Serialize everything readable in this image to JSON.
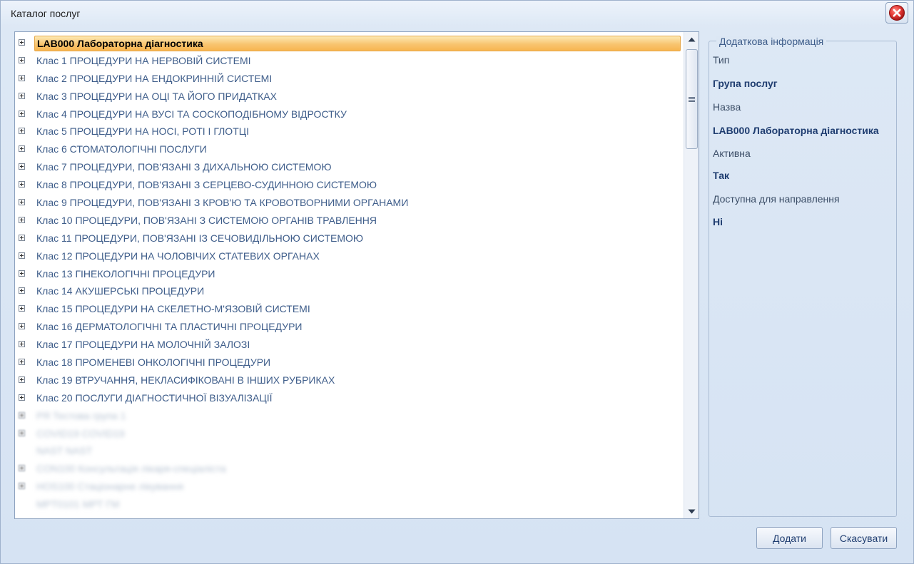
{
  "window": {
    "title": "Каталог послуг"
  },
  "tree": {
    "items": [
      {
        "label": "LAB000 Лабораторна діагностика",
        "selected": true,
        "expandable": true
      },
      {
        "label": "Клас 1 ПРОЦЕДУРИ НА НЕРВОВІЙ СИСТЕМІ",
        "expandable": true
      },
      {
        "label": "Клас 2 ПРОЦЕДУРИ НА ЕНДОКРИННІЙ СИСТЕМІ",
        "expandable": true
      },
      {
        "label": "Клас 3 ПРОЦЕДУРИ НА ОЦІ ТА ЙОГО ПРИДАТКАХ",
        "expandable": true
      },
      {
        "label": "Клас 4 ПРОЦЕДУРИ НА ВУСІ ТА СОСКОПОДІБНОМУ ВІДРОСТКУ",
        "expandable": true
      },
      {
        "label": "Клас 5 ПРОЦЕДУРИ НА НОСІ, РОТІ І ГЛОТЦІ",
        "expandable": true
      },
      {
        "label": "Клас 6 СТОМАТОЛОГІЧНІ ПОСЛУГИ",
        "expandable": true
      },
      {
        "label": "Клас 7 ПРОЦЕДУРИ, ПОВ'ЯЗАНІ З ДИХАЛЬНОЮ СИСТЕМОЮ",
        "expandable": true
      },
      {
        "label": "Клас 8 ПРОЦЕДУРИ, ПОВ'ЯЗАНІ З СЕРЦЕВО-СУДИННОЮ СИСТЕМОЮ",
        "expandable": true
      },
      {
        "label": "Клас 9 ПРОЦЕДУРИ, ПОВ'ЯЗАНІ З КРОВ'Ю ТА КРОВОТВОРНИМИ ОРГАНАМИ",
        "expandable": true
      },
      {
        "label": "Клас 10 ПРОЦЕДУРИ, ПОВ'ЯЗАНІ З СИСТЕМОЮ ОРГАНІВ ТРАВЛЕННЯ",
        "expandable": true
      },
      {
        "label": "Клас 11 ПРОЦЕДУРИ, ПОВ'ЯЗАНІ ІЗ СЕЧОВИДІЛЬНОЮ СИСТЕМОЮ",
        "expandable": true
      },
      {
        "label": "Клас 12 ПРОЦЕДУРИ НА ЧОЛОВІЧИХ СТАТЕВИХ ОРГАНАХ",
        "expandable": true
      },
      {
        "label": "Клас 13 ГІНЕКОЛОГІЧНІ ПРОЦЕДУРИ",
        "expandable": true
      },
      {
        "label": "Клас 14 АКУШЕРСЬКІ ПРОЦЕДУРИ",
        "expandable": true
      },
      {
        "label": "Клас 15 ПРОЦЕДУРИ НА СКЕЛЕТНО-М'ЯЗОВІЙ СИСТЕМІ",
        "expandable": true
      },
      {
        "label": "Клас 16 ДЕРМАТОЛОГІЧНІ ТА ПЛАСТИЧНІ ПРОЦЕДУРИ",
        "expandable": true
      },
      {
        "label": "Клас 17 ПРОЦЕДУРИ НА МОЛОЧНІЙ ЗАЛОЗІ",
        "expandable": true
      },
      {
        "label": "Клас 18 ПРОМЕНЕВІ ОНКОЛОГІЧНІ ПРОЦЕДУРИ",
        "expandable": true
      },
      {
        "label": "Клас 19 ВТРУЧАННЯ, НЕКЛАСИФІКОВАНІ В ІНШИХ РУБРИКАХ",
        "expandable": true
      },
      {
        "label": "Клас 20 ПОСЛУГИ ДІАГНОСТИЧНОЇ ВІЗУАЛІЗАЦІЇ",
        "expandable": true
      },
      {
        "label": "РЯ Тестова група 1",
        "expandable": true,
        "blurred": true
      },
      {
        "label": "COVID19 COVID19",
        "expandable": true,
        "blurred": true
      },
      {
        "label": "NAST NAST",
        "expandable": false,
        "blurred": true
      },
      {
        "label": "CON100 Консультація лікаря-спеціаліста",
        "expandable": true,
        "blurred": true
      },
      {
        "label": "HOS100 Стаціонарне лікування",
        "expandable": true,
        "blurred": true
      },
      {
        "label": "MPT0101 МРТ ГМ",
        "expandable": false,
        "blurred": true
      }
    ]
  },
  "info": {
    "legend": "Додаткова інформація",
    "type_label": "Тип",
    "type_value": "Група послуг",
    "name_label": "Назва",
    "name_value": "LAB000 Лабораторна діагностика",
    "active_label": "Активна",
    "active_value": "Так",
    "referral_label": "Доступна для направлення",
    "referral_value": "Ні"
  },
  "buttons": {
    "add": "Додати",
    "cancel": "Скасувати"
  },
  "colors": {
    "selection": "#f8c570",
    "link_text": "#3e5d8a",
    "close_icon": "#d8232a"
  },
  "icons": {
    "close": "close-icon",
    "expand": "plus-box-icon",
    "scroll_up": "arrow-up-icon",
    "scroll_down": "arrow-down-icon"
  }
}
